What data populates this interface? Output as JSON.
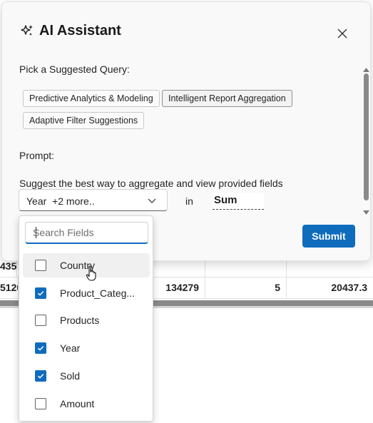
{
  "background_grid": {
    "row1": [
      "435",
      "",
      "",
      "",
      ""
    ],
    "row2": [
      "5120",
      "",
      "134279",
      "5",
      "20437.3"
    ]
  },
  "dialog": {
    "title": "AI Assistant",
    "title_icon": "sparkle-icon",
    "close_icon": "close-icon",
    "suggested_label": "Pick a Suggested Query:",
    "suggestions": [
      "Predictive Analytics & Modeling",
      "Intelligent Report Aggregation",
      "Adaptive Filter Suggestions"
    ],
    "prompt_label": "Prompt:",
    "prompt_text": "Suggest the best way to aggregate and view provided fields",
    "fields_value": "Year  +2 more..",
    "in_label": "in",
    "aggregate_value": "Sum",
    "submit_label": "Submit"
  },
  "dropdown": {
    "search_placeholder": "Search Fields",
    "options": [
      {
        "label": "Country",
        "checked": false
      },
      {
        "label": "Product_Categ...",
        "checked": true
      },
      {
        "label": "Products",
        "checked": false
      },
      {
        "label": "Year",
        "checked": true
      },
      {
        "label": "Sold",
        "checked": true
      },
      {
        "label": "Amount",
        "checked": false
      }
    ]
  },
  "colors": {
    "accent": "#0f6cbd",
    "dialog_bg": "#f9f9f9"
  }
}
